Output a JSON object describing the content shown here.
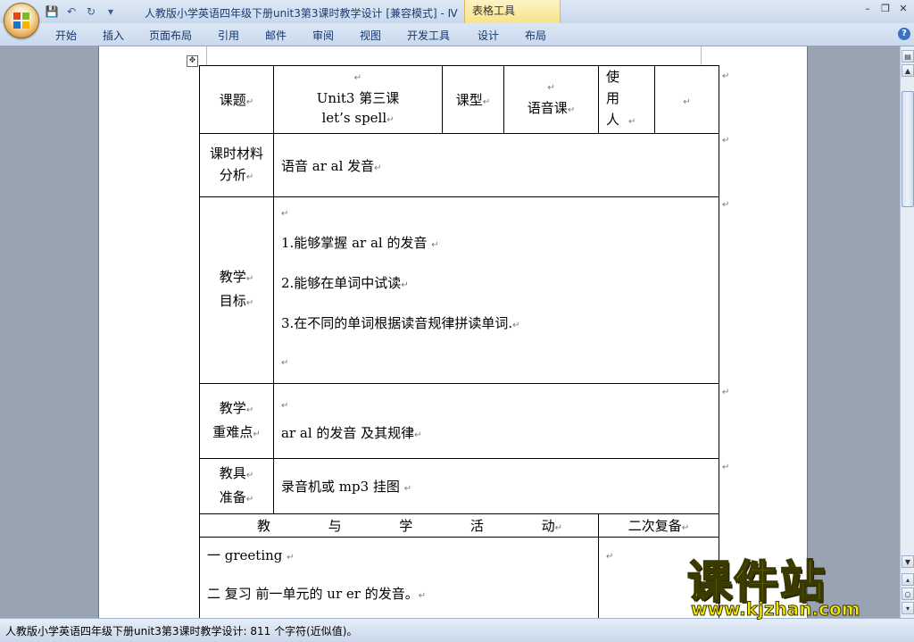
{
  "titlebar": {
    "doc_title": "人教版小学英语四年级下册unit3第3课时教学设计 [兼容模式] - Ⅳ",
    "context_tab_title": "表格工具",
    "qat_icons": [
      "save-icon",
      "undo-icon",
      "redo-icon",
      "customize-icon"
    ],
    "window_controls": [
      "minimize",
      "restore",
      "close"
    ]
  },
  "ribbon": {
    "tabs": [
      "开始",
      "插入",
      "页面布局",
      "引用",
      "邮件",
      "审阅",
      "视图",
      "开发工具",
      "设计",
      "布局"
    ]
  },
  "table": {
    "row1": {
      "label": "课题",
      "title_line1": "Unit3  第三课",
      "title_line2": "let’s spell",
      "type_label": "课型",
      "type_value": "语音课",
      "user_label": "使 用 人",
      "user_value": ""
    },
    "analysis": {
      "label_line1": "课时材料",
      "label_line2": "分析",
      "value": "语音  ar al  发音"
    },
    "goals": {
      "label_line1": "教学",
      "label_line2": "目标",
      "items": [
        "1.能够掌握 ar al  的发音",
        "2.能够在单词中试读",
        "3.在不同的单词根据读音规律拼读单词."
      ]
    },
    "difficulty": {
      "label_line1": "教学",
      "label_line2": "重难点",
      "value": "ar  al 的发音 及其规律"
    },
    "tools": {
      "label_line1": "教具",
      "label_line2": "准备",
      "value": "录音机或 mp3  挂图"
    },
    "activities_header": {
      "chars": [
        "教",
        "与",
        "学",
        "活",
        "动"
      ],
      "review": "二次复备"
    },
    "activities": [
      "一 greeting",
      "二  复习  前一单元的 ur er  的发音。"
    ]
  },
  "statusbar": {
    "text": "人教版小学英语四年级下册unit3第3课时教学设计: 811 个字符(近似值)。"
  },
  "watermark": {
    "title": "课件站",
    "url": "www.kjzhan.com"
  }
}
